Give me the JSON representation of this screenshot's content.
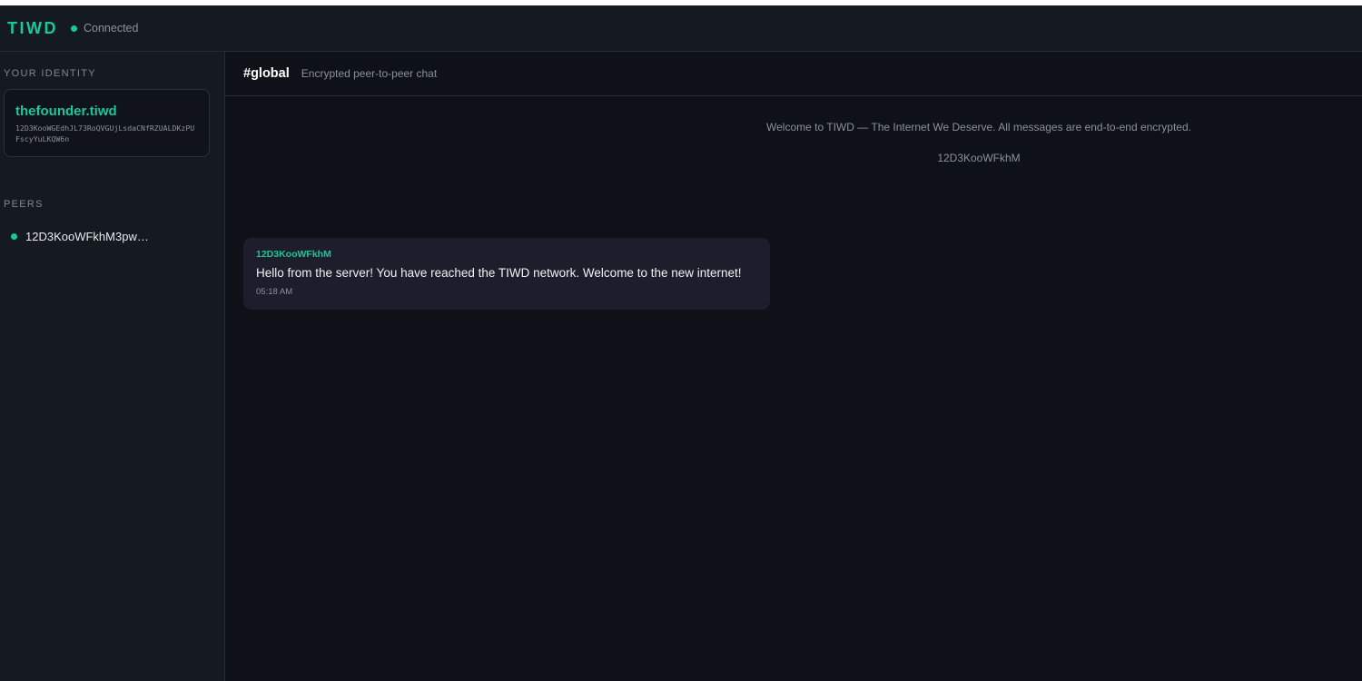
{
  "app": {
    "logo": "TIWD",
    "status": "Connected",
    "accent_color": "#19c79a"
  },
  "sidebar": {
    "identity_label": "YOUR IDENTITY",
    "identity": {
      "name": "thefounder.tiwd",
      "peer_id": "12D3KooWGEdhJL73RoQVGUjLsdaCNfRZUALDKzPUFscyYuLKQW6n"
    },
    "peers_label": "PEERS",
    "peers": [
      {
        "label": "12D3KooWFkhM3pwY..."
      }
    ]
  },
  "channel": {
    "name": "#global",
    "description": "Encrypted peer-to-peer chat"
  },
  "system_messages": [
    "Welcome to TIWD — The Internet We Deserve. All messages are end-to-end encrypted.",
    "12D3KooWFkhM"
  ],
  "messages": [
    {
      "sender": "12D3KooWFkhM",
      "text": "Hello from the server! You have reached the TIWD network. Welcome to the new internet!",
      "time": "05:18 AM"
    }
  ]
}
